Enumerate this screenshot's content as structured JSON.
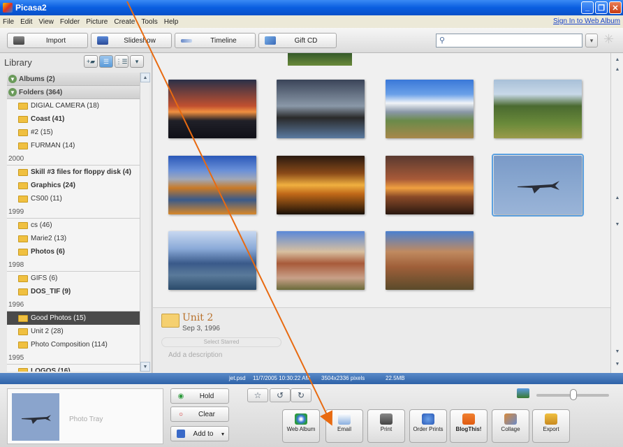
{
  "window": {
    "title": "Picasa2"
  },
  "menu": {
    "items": [
      "File",
      "Edit",
      "View",
      "Folder",
      "Picture",
      "Create",
      "Tools",
      "Help"
    ],
    "signin": "Sign In to Web Album"
  },
  "toolbar": {
    "import": "Import",
    "slideshow": "Slideshow",
    "timeline": "Timeline",
    "giftcd": "Gift CD"
  },
  "library": {
    "title": "Library",
    "rows": [
      {
        "kind": "group",
        "label": "Albums (2)"
      },
      {
        "kind": "group",
        "label": "Folders (364)"
      },
      {
        "kind": "folder",
        "label": "DIGIAL CAMERA (18)",
        "bold": false
      },
      {
        "kind": "folder",
        "label": "Coast (41)",
        "bold": true
      },
      {
        "kind": "folder",
        "label": "#2 (15)",
        "bold": false
      },
      {
        "kind": "folder",
        "label": "FURMAN (14)",
        "bold": false
      },
      {
        "kind": "year",
        "label": "2000"
      },
      {
        "kind": "folder",
        "label": "Skill #3 files for floppy disk (4)",
        "bold": true
      },
      {
        "kind": "folder",
        "label": "Graphics (24)",
        "bold": true
      },
      {
        "kind": "folder",
        "label": "CS00 (11)",
        "bold": false
      },
      {
        "kind": "year",
        "label": "1999"
      },
      {
        "kind": "folder",
        "label": "cs (46)",
        "bold": false
      },
      {
        "kind": "folder",
        "label": "Marie2 (13)",
        "bold": false
      },
      {
        "kind": "folder",
        "label": "Photos (6)",
        "bold": true
      },
      {
        "kind": "year",
        "label": "1998"
      },
      {
        "kind": "folder",
        "label": "GIFS (6)",
        "bold": false
      },
      {
        "kind": "folder",
        "label": "DOS_TIF (9)",
        "bold": true
      },
      {
        "kind": "year",
        "label": "1996"
      },
      {
        "kind": "folder",
        "label": "Good Photos (15)",
        "bold": false,
        "selected": true
      },
      {
        "kind": "folder",
        "label": "Unit 2 (28)",
        "bold": false
      },
      {
        "kind": "folder",
        "label": "Photo Composition (114)",
        "bold": false
      },
      {
        "kind": "year",
        "label": "1995"
      },
      {
        "kind": "folder",
        "label": "LOGOS (16)",
        "bold": true
      }
    ]
  },
  "photos": [
    {
      "name": "pier-sunset",
      "selected": false
    },
    {
      "name": "palm-sunset",
      "selected": false
    },
    {
      "name": "snowy-mountains",
      "selected": false
    },
    {
      "name": "green-valley",
      "selected": false
    },
    {
      "name": "autumn-lake",
      "selected": false
    },
    {
      "name": "cloud-sunset",
      "selected": false
    },
    {
      "name": "ocean-sunset",
      "selected": false
    },
    {
      "name": "jet-in-sky",
      "selected": true
    },
    {
      "name": "lake-aerial",
      "selected": false
    },
    {
      "name": "canyon-rocks",
      "selected": false
    },
    {
      "name": "red-cliffs",
      "selected": false
    }
  ],
  "unit": {
    "title": "Unit 2",
    "date": "Sep 3, 1996",
    "select_starred": "Select Starred",
    "description_placeholder": "Add a description"
  },
  "status": {
    "file": "jet.psd",
    "datetime": "11/7/2005 10:30:22 AM",
    "size": "3504x2336 pixels",
    "filesize": "22.5MB"
  },
  "tray": {
    "label": "Photo Tray",
    "hold": "Hold",
    "clear": "Clear",
    "addto": "Add to"
  },
  "actions": [
    {
      "label": "Web Album",
      "icon": "globe-icon"
    },
    {
      "label": "Email",
      "icon": "email-icon"
    },
    {
      "label": "Print",
      "icon": "printer-icon"
    },
    {
      "label": "Order Prints",
      "icon": "order-prints-icon"
    },
    {
      "label": "BlogThis!",
      "icon": "blogger-icon"
    },
    {
      "label": "Collage",
      "icon": "collage-icon"
    },
    {
      "label": "Export",
      "icon": "export-icon"
    }
  ],
  "colors": {
    "accent": "#0a5ee0",
    "selection": "#5aa0e0",
    "annotation_arrow": "#e86a10"
  }
}
